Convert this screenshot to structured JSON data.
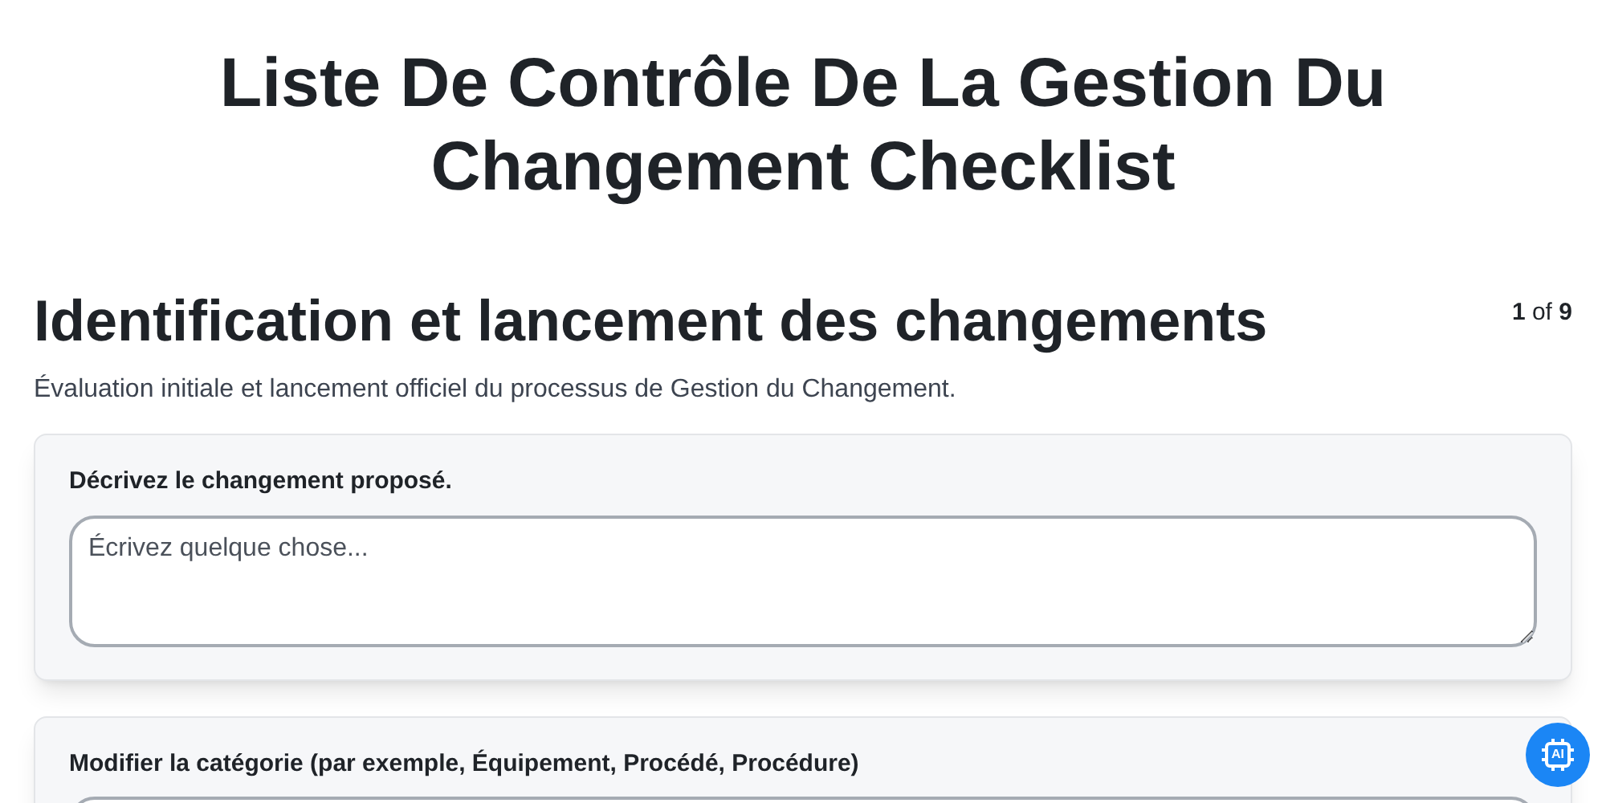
{
  "title": "Liste De Contrôle De La Gestion Du Changement Checklist",
  "section": {
    "heading": "Identification et lancement des changements",
    "page": "1",
    "of": "of",
    "total": "9",
    "description": "Évaluation initiale et lancement officiel du processus de Gestion du Changement."
  },
  "questions": [
    {
      "label": "Décrivez le changement proposé.",
      "kind": "textarea",
      "placeholder": "Écrivez quelque chose..."
    },
    {
      "label": "Modifier la catégorie (par exemple, Équipement, Procédé, Procédure)",
      "kind": "text"
    }
  ],
  "ai_button": {
    "label": "AI"
  }
}
